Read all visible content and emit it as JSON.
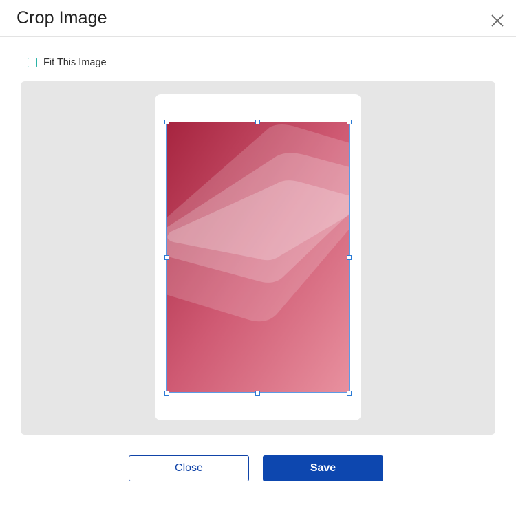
{
  "dialog": {
    "title": "Crop Image",
    "close_icon": "close-icon"
  },
  "fit_option": {
    "label": "Fit This Image",
    "checked": false
  },
  "crop": {
    "image_description_colors": {
      "gradient_start": "#a6243f",
      "gradient_end": "#e8919f"
    },
    "handle_color": "#2a7bd6"
  },
  "buttons": {
    "close_label": "Close",
    "save_label": "Save"
  },
  "colors": {
    "primary": "#0d47af",
    "checkbox_border": "#2bb3a6",
    "canvas_bg": "#e6e6e6"
  }
}
